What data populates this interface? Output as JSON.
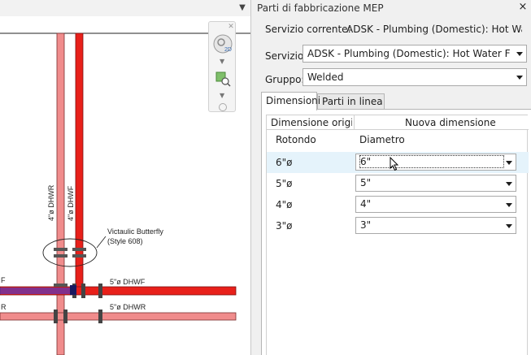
{
  "drawing": {
    "labels": {
      "pipe_vertical_1": "4\"ø DHWR",
      "pipe_vertical_2": "4\"ø DHWF",
      "valve_note_line1": "Victaulic Butterfly",
      "valve_note_line2": "(Style 608)",
      "pipe_h1": "5\"ø DHWF",
      "pipe_h2": "5\"ø DHWR",
      "edge_f": "F",
      "edge_r": "R"
    },
    "colors": {
      "supply_pipe": "#e8201a",
      "return_pipe": "#f08c8c",
      "highlight_pipe": "#3c3cd8"
    }
  },
  "panel": {
    "title": "Parti di fabbricazione MEP",
    "close_icon": "×",
    "current_service_label": "Servizio corrente:",
    "current_service_value": "ADSK - Plumbing (Domestic): Hot Wat...",
    "service_label": "Servizio:",
    "service_value": "ADSK - Plumbing (Domestic): Hot Water Flo...",
    "group_label": "Gruppo:",
    "group_value": "Welded",
    "tabs": [
      {
        "label": "Dimensioni",
        "active": true
      },
      {
        "label": "Parti in linea",
        "active": false
      }
    ],
    "grid": {
      "col_original": "Dimensione origi...",
      "col_new": "Nuova dimensione",
      "sub_shape": "Rotondo",
      "sub_diameter": "Diametro",
      "rows": [
        {
          "size": "6\"ø",
          "new": "6\"",
          "selected": true
        },
        {
          "size": "5\"ø",
          "new": "5\"",
          "selected": false
        },
        {
          "size": "4\"ø",
          "new": "4\"",
          "selected": false
        },
        {
          "size": "3\"ø",
          "new": "3\"",
          "selected": false
        }
      ]
    }
  }
}
